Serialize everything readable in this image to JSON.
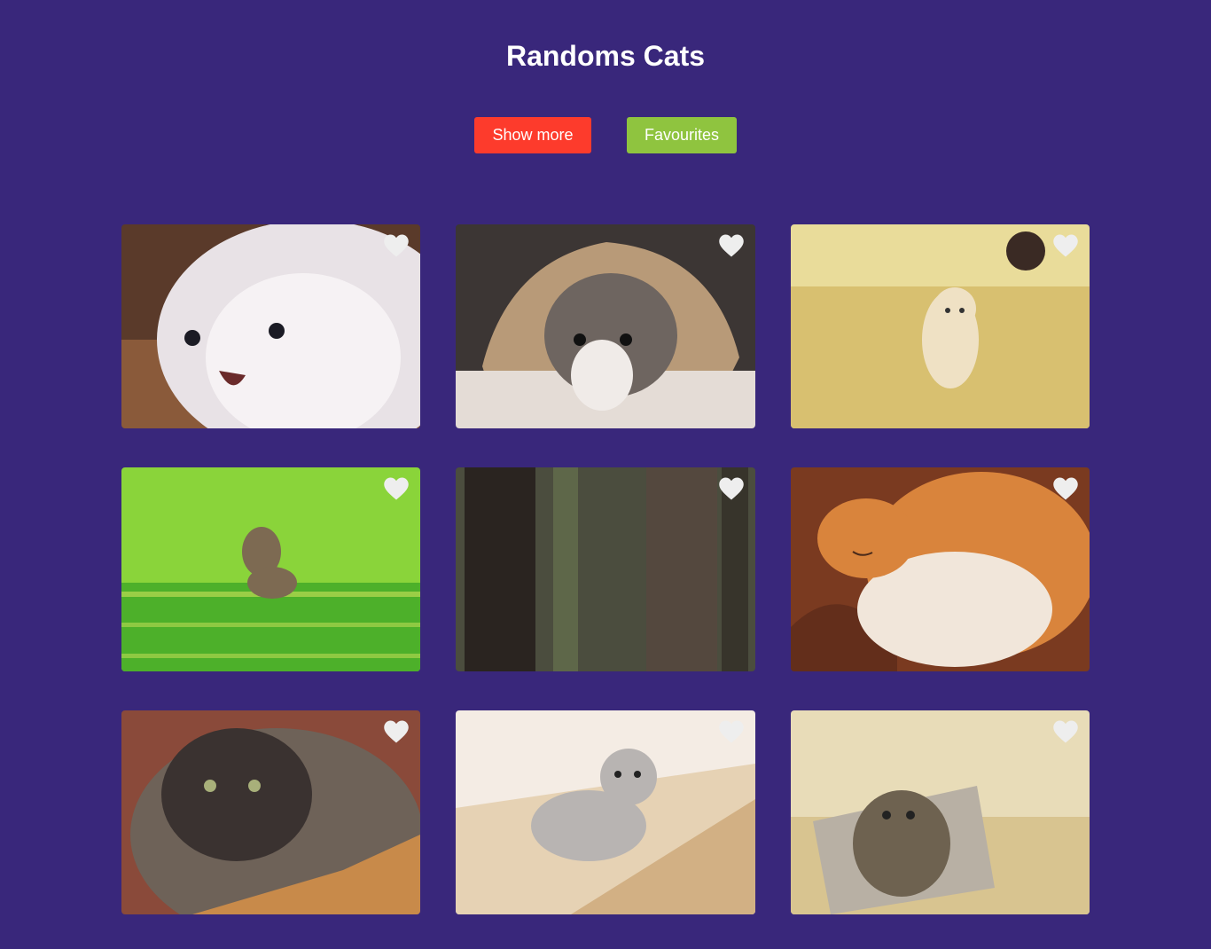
{
  "header": {
    "title": "Randoms Cats"
  },
  "toolbar": {
    "show_more_label": "Show more",
    "favourites_label": "Favourites"
  },
  "colors": {
    "background": "#39277b",
    "show_more": "#fd3b2c",
    "favourites": "#8fc43f",
    "heart": "#eeeeee"
  },
  "cards": [
    {
      "subject": "white fluffy kitten",
      "palette": [
        "#5a3a2a",
        "#8a5a3a",
        "#e8e2e6",
        "#f6f2f4"
      ],
      "favourite": false
    },
    {
      "subject": "grey and white cat in paper bag",
      "palette": [
        "#3c3634",
        "#b89a78",
        "#6e6560",
        "#e4dcd6"
      ],
      "favourite": false
    },
    {
      "subject": "cream kitten walking on wood floor",
      "palette": [
        "#e9dc9a",
        "#d8c070",
        "#efe1c4",
        "#3a2a24"
      ],
      "favourite": false
    },
    {
      "subject": "tabby kitten jumping in grass",
      "palette": [
        "#4db02a",
        "#8ad43a",
        "#cfe25a",
        "#7d6a52"
      ],
      "favourite": false
    },
    {
      "subject": "trees in forest",
      "palette": [
        "#2a2420",
        "#54483e",
        "#3d5a3e",
        "#6a7a52"
      ],
      "favourite": false
    },
    {
      "subject": "orange and white cat sleeping on rug",
      "palette": [
        "#7a3a20",
        "#d9843c",
        "#f1e6da",
        "#5a2a1a"
      ],
      "favourite": false
    },
    {
      "subject": "tortoiseshell kitten",
      "palette": [
        "#8a4a3a",
        "#3a3230",
        "#6e6258",
        "#c88a4a"
      ],
      "favourite": false
    },
    {
      "subject": "grey kitten on wooden floor",
      "palette": [
        "#e6d2b4",
        "#c49a64",
        "#b8b4b2",
        "#f4ece4"
      ],
      "favourite": false
    },
    {
      "subject": "tabby cat in litter box",
      "palette": [
        "#e8dcb8",
        "#b8b0a4",
        "#6e6250",
        "#d8c490"
      ],
      "favourite": false
    }
  ]
}
